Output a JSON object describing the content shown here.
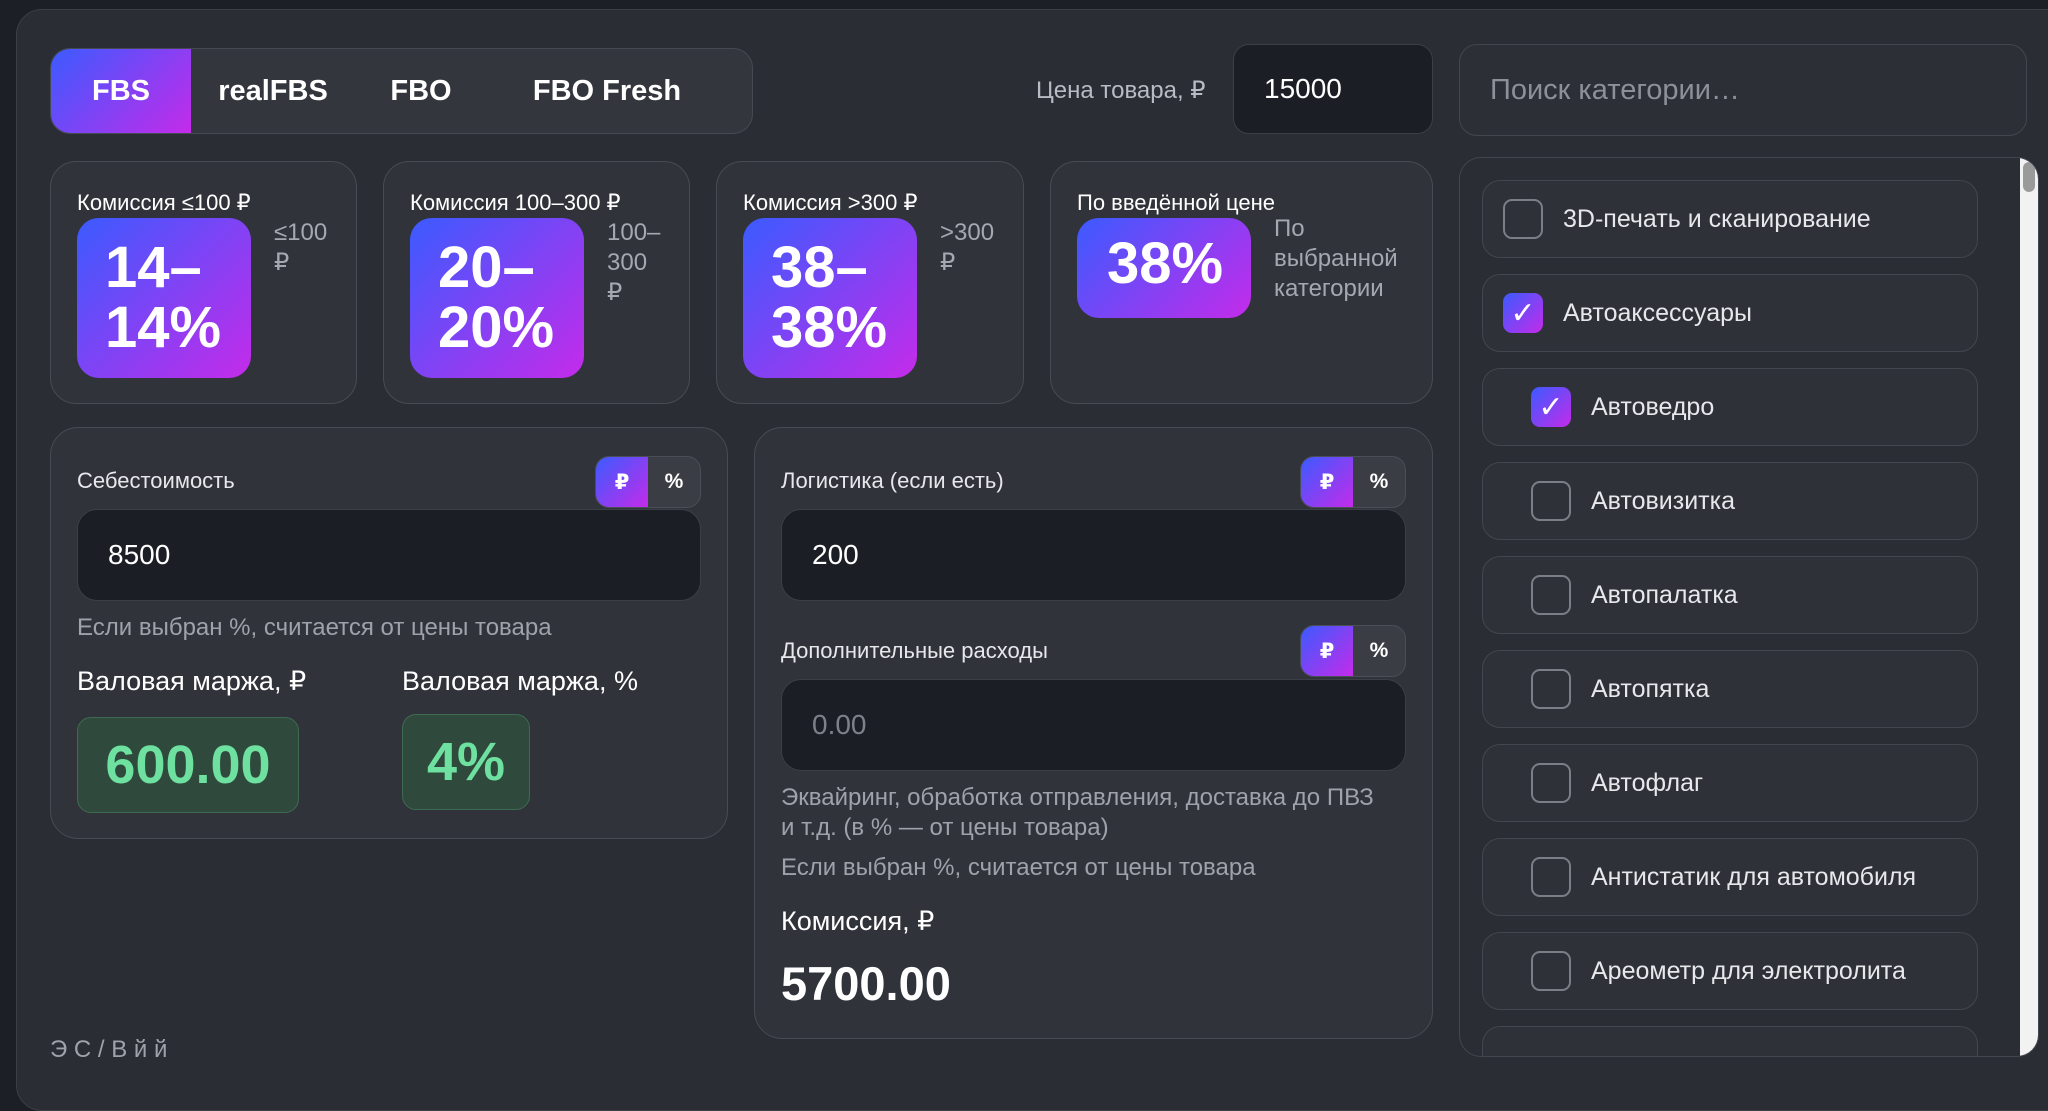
{
  "tabs": [
    "FBS",
    "realFBS",
    "FBO",
    "FBO Fresh"
  ],
  "price": {
    "label": "Цена товара, ₽",
    "value": "15000"
  },
  "search": {
    "placeholder": "Поиск категории…"
  },
  "commission_cards": [
    {
      "title": "Комиссия ≤100 ₽",
      "value_line1": "14–",
      "value_line2": "14%",
      "note": "≤100\n₽"
    },
    {
      "title": "Комиссия 100–300 ₽",
      "value_line1": "20–",
      "value_line2": "20%",
      "note": "100–\n300\n₽"
    },
    {
      "title": "Комиссия >300 ₽",
      "value_line1": "38–",
      "value_line2": "38%",
      "note": ">300\n₽"
    },
    {
      "title": "По введённой цене",
      "value": "38%",
      "note": "По\nвыбранной\nкатегории"
    }
  ],
  "cost": {
    "label": "Себестоимость",
    "unit_rub": "₽",
    "unit_pct": "%",
    "value": "8500",
    "hint": "Если выбран %, считается от цены товара"
  },
  "margin": {
    "rub_label": "Валовая маржа, ₽",
    "rub_value": "600.00",
    "pct_label": "Валовая маржа, %",
    "pct_value": "4%"
  },
  "logistics": {
    "label": "Логистика (если есть)",
    "unit_rub": "₽",
    "unit_pct": "%",
    "value": "200"
  },
  "extra": {
    "label": "Дополнительные расходы",
    "unit_rub": "₽",
    "unit_pct": "%",
    "placeholder": "0.00",
    "hint1": "Эквайринг, обработка отправления, доставка до ПВЗ и т.д. (в % — от цены товара)",
    "hint2": "Если выбран %, считается от цены товара"
  },
  "commission_result": {
    "label": "Комиссия, ₽",
    "value": "5700.00"
  },
  "categories": [
    {
      "label": "3D-печать и сканирование",
      "checked": false
    },
    {
      "label": "Автоаксессуары",
      "checked": true
    },
    {
      "label": "Автоведро",
      "checked": true
    },
    {
      "label": "Автовизитка",
      "checked": false
    },
    {
      "label": "Автопалатка",
      "checked": false
    },
    {
      "label": "Автопятка",
      "checked": false
    },
    {
      "label": "Автофлаг",
      "checked": false
    },
    {
      "label": "Антистатик для автомобиля",
      "checked": false
    },
    {
      "label": "Ареометр для электролита",
      "checked": false
    }
  ],
  "check_mark": "✓",
  "footer": "Э                     С                    /          В                         й                                              й"
}
